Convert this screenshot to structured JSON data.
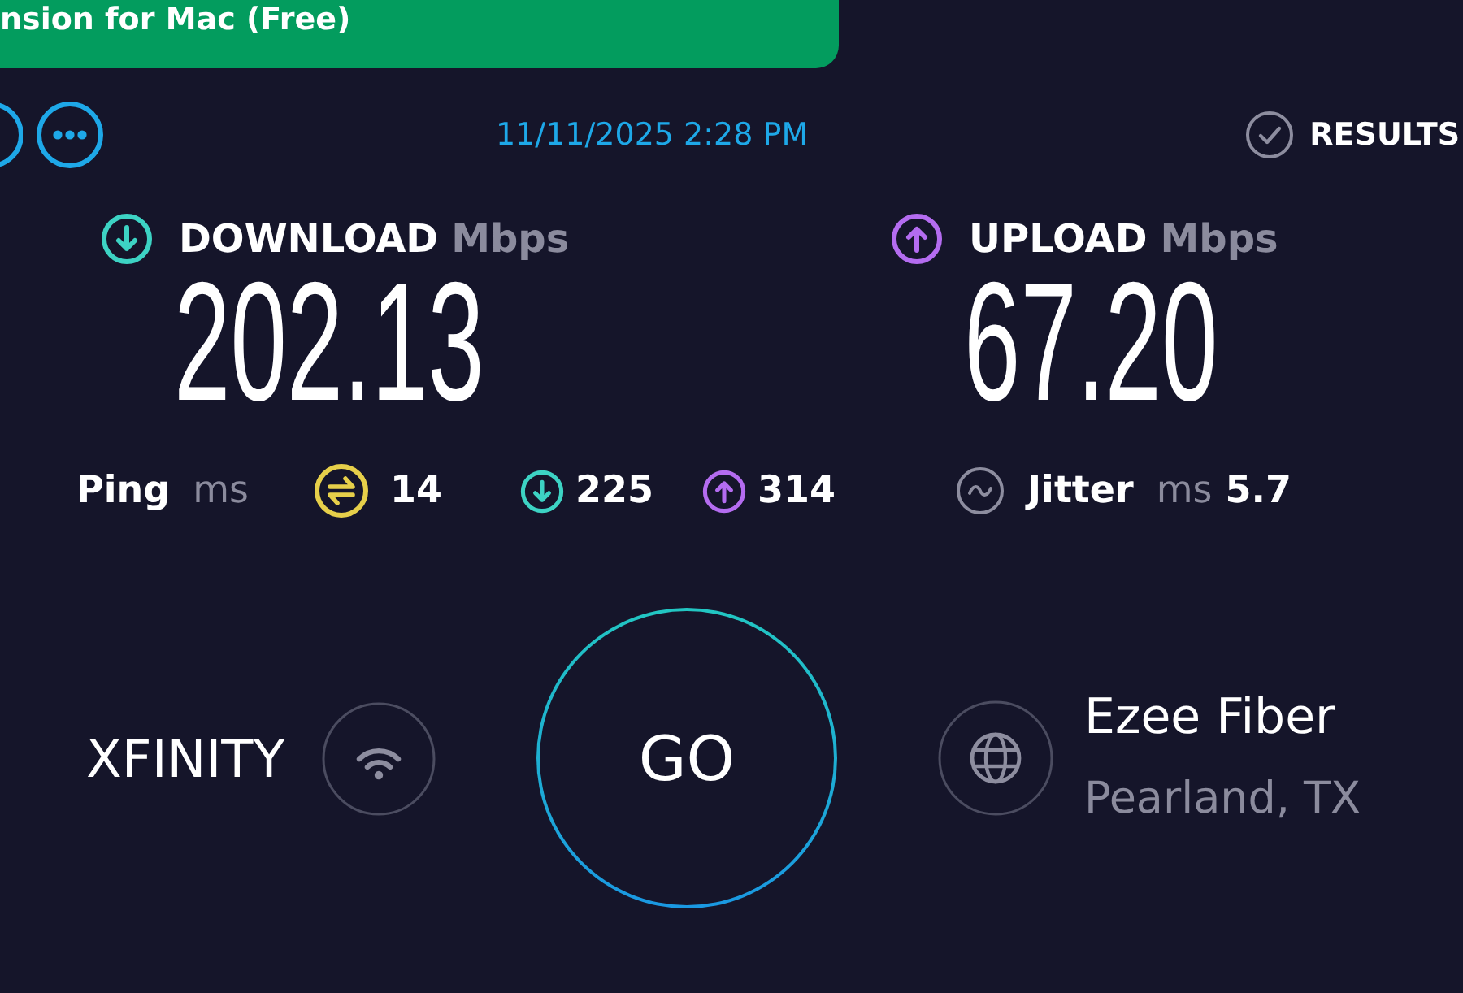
{
  "banner": {
    "text": "nsion for Mac (Free)"
  },
  "toolbar": {
    "timestamp": "11/11/2025 2:28 PM",
    "results_label": "RESULTS"
  },
  "speeds": [
    {
      "kind": "download",
      "label": "DOWNLOAD",
      "unit": "Mbps",
      "value": "202.13"
    },
    {
      "kind": "upload",
      "label": "UPLOAD",
      "unit": "Mbps",
      "value": "67.20"
    }
  ],
  "ping": {
    "label": "Ping",
    "unit": "ms",
    "metrics": [
      {
        "kind": "idle",
        "value": "14"
      },
      {
        "kind": "download",
        "value": "225"
      },
      {
        "kind": "upload",
        "value": "314"
      }
    ]
  },
  "jitter": {
    "label": "Jitter",
    "unit": "ms",
    "value": "5.7"
  },
  "connection": {
    "provider": "XFINITY",
    "go_label": "GO",
    "server_name": "Ezee Fiber",
    "server_location": "Pearland, TX"
  }
}
